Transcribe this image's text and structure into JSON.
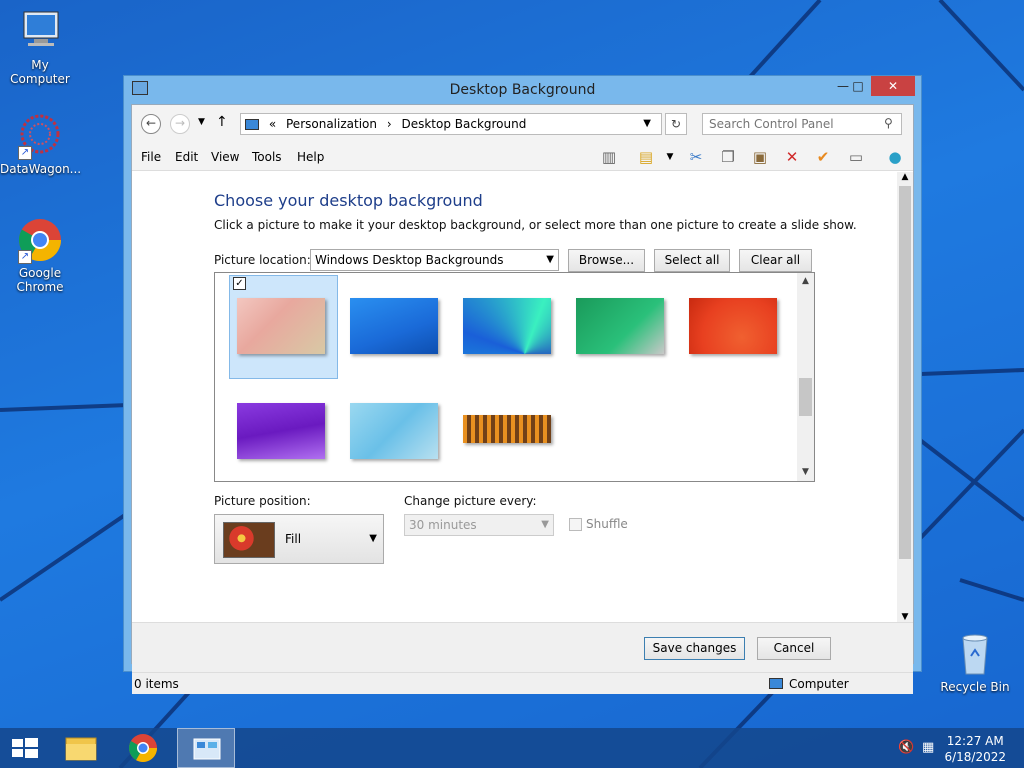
{
  "desktop": {
    "icons": [
      {
        "label": "My Computer"
      },
      {
        "label": "DataWagon..."
      },
      {
        "label": "Google Chrome"
      },
      {
        "label": "Recycle Bin"
      }
    ]
  },
  "window": {
    "title": "Desktop Background",
    "controls": {
      "minimize": "—",
      "maximize": "□",
      "close": "✕"
    },
    "address": {
      "prefix": "«",
      "crumbs": [
        "Personalization",
        "Desktop Background"
      ],
      "search_placeholder": "Search Control Panel"
    },
    "menu": [
      "File",
      "Edit",
      "View",
      "Tools",
      "Help"
    ],
    "content": {
      "heading": "Choose your desktop background",
      "description": "Click a picture to make it your desktop background, or select more than one picture to create a slide show.",
      "picture_location_label": "Picture location:",
      "picture_location_value": "Windows Desktop Backgrounds",
      "browse_label": "Browse...",
      "select_all_label": "Select all",
      "clear_all_label": "Clear all",
      "picture_position_label": "Picture position:",
      "picture_position_value": "Fill",
      "change_picture_label": "Change picture every:",
      "change_picture_value": "30 minutes",
      "shuffle_label": "Shuffle"
    },
    "footer": {
      "save_label": "Save changes",
      "cancel_label": "Cancel"
    },
    "status": {
      "items": "0 items",
      "location": "Computer"
    }
  },
  "taskbar": {
    "time": "12:27 AM",
    "date": "6/18/2022"
  },
  "colors": {
    "accent": "#1e3e8a",
    "titlebar": "#79b8ec",
    "close": "#c94242"
  }
}
